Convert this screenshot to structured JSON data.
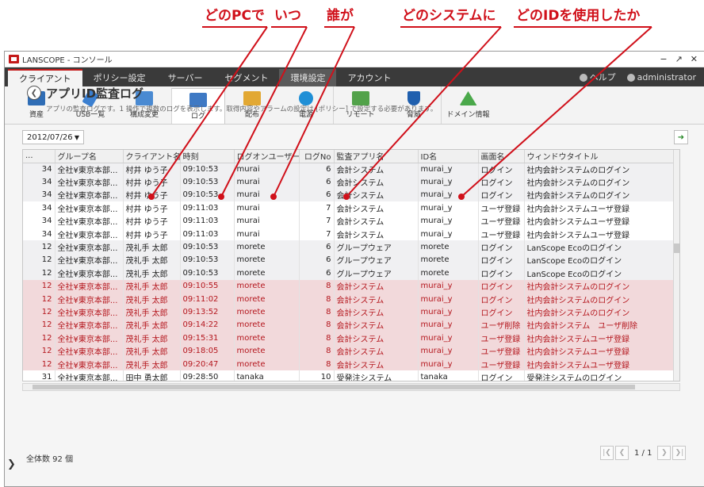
{
  "annotations": [
    "どのPCで",
    "いつ",
    "誰が",
    "どのシステムに",
    "どのIDを使用したか"
  ],
  "window": {
    "title": "LANSCOPE - コンソール",
    "controls": [
      "−",
      "↗",
      "✕"
    ]
  },
  "menubar": {
    "tabs": [
      "クライアント",
      "ポリシー設定",
      "サーバー",
      "セグメント",
      "環境設定",
      "アカウント"
    ],
    "help": "ヘルプ",
    "user": "administrator"
  },
  "toolbar": [
    "資産",
    "USB一覧",
    "構成変更",
    "ログ",
    "配布",
    "電源",
    "リモート",
    "脅威",
    "ドメイン情報"
  ],
  "page": {
    "title": "アプリID監査ログ",
    "description": "アプリの監査ログです。1 操作で複数のログを表示します。取得内容やアラームの設定は [ポリシー] で設定する必要があります。"
  },
  "date_filter": "2012/07/26",
  "table": {
    "columns": [
      "...",
      "グループ名",
      "クライアント名",
      "時刻",
      "ログオンユーザー名",
      "ログNo",
      "監査アプリ名",
      "ID名",
      "画面名",
      "ウィンドウタイトル"
    ],
    "rows": [
      {
        "style": "gray",
        "cells": [
          "34",
          "全社¥東京本部...",
          "村井 ゆう子",
          "09:10:53",
          "murai",
          "6",
          "会計システム",
          "murai_y",
          "ログイン",
          "社内会計システムのログイン"
        ]
      },
      {
        "style": "gray",
        "cells": [
          "34",
          "全社¥東京本部...",
          "村井 ゆう子",
          "09:10:53",
          "murai",
          "6",
          "会計システム",
          "murai_y",
          "ログイン",
          "社内会計システムのログイン"
        ]
      },
      {
        "style": "gray",
        "cells": [
          "34",
          "全社¥東京本部...",
          "村井 ゆう子",
          "09:10:53",
          "murai",
          "6",
          "会計システム",
          "murai_y",
          "ログイン",
          "社内会計システムのログイン"
        ]
      },
      {
        "style": "white",
        "cells": [
          "34",
          "全社¥東京本部...",
          "村井 ゆう子",
          "09:11:03",
          "murai",
          "7",
          "会計システム",
          "murai_y",
          "ユーザ登録",
          "社内会計システムユーザ登録"
        ]
      },
      {
        "style": "white",
        "cells": [
          "34",
          "全社¥東京本部...",
          "村井 ゆう子",
          "09:11:03",
          "murai",
          "7",
          "会計システム",
          "murai_y",
          "ユーザ登録",
          "社内会計システムユーザ登録"
        ]
      },
      {
        "style": "white",
        "cells": [
          "34",
          "全社¥東京本部...",
          "村井 ゆう子",
          "09:11:03",
          "murai",
          "7",
          "会計システム",
          "murai_y",
          "ユーザ登録",
          "社内会計システムユーザ登録"
        ]
      },
      {
        "style": "gray",
        "cells": [
          "12",
          "全社¥東京本部...",
          "茂礼手 太郎",
          "09:10:53",
          "morete",
          "6",
          "グループウェア",
          "morete",
          "ログイン",
          "LanScope Ecoのログイン"
        ]
      },
      {
        "style": "gray",
        "cells": [
          "12",
          "全社¥東京本部...",
          "茂礼手 太郎",
          "09:10:53",
          "morete",
          "6",
          "グループウェア",
          "morete",
          "ログイン",
          "LanScope Ecoのログイン"
        ]
      },
      {
        "style": "gray",
        "cells": [
          "12",
          "全社¥東京本部...",
          "茂礼手 太郎",
          "09:10:53",
          "morete",
          "6",
          "グループウェア",
          "morete",
          "ログイン",
          "LanScope Ecoのログイン"
        ]
      },
      {
        "style": "red",
        "cells": [
          "12",
          "全社¥東京本部...",
          "茂礼手 太郎",
          "09:10:55",
          "morete",
          "8",
          "会計システム",
          "murai_y",
          "ログイン",
          "社内会計システムのログイン"
        ]
      },
      {
        "style": "red",
        "cells": [
          "12",
          "全社¥東京本部...",
          "茂礼手 太郎",
          "09:11:02",
          "morete",
          "8",
          "会計システム",
          "murai_y",
          "ログイン",
          "社内会計システムのログイン"
        ]
      },
      {
        "style": "red",
        "cells": [
          "12",
          "全社¥東京本部...",
          "茂礼手 太郎",
          "09:13:52",
          "morete",
          "8",
          "会計システム",
          "murai_y",
          "ログイン",
          "社内会計システムのログイン"
        ]
      },
      {
        "style": "red",
        "cells": [
          "12",
          "全社¥東京本部...",
          "茂礼手 太郎",
          "09:14:22",
          "morete",
          "8",
          "会計システム",
          "murai_y",
          "ユーザ削除",
          "社内会計システム　ユーザ削除"
        ]
      },
      {
        "style": "red",
        "cells": [
          "12",
          "全社¥東京本部...",
          "茂礼手 太郎",
          "09:15:31",
          "morete",
          "8",
          "会計システム",
          "murai_y",
          "ユーザ登録",
          "社内会計システムユーザ登録"
        ]
      },
      {
        "style": "red",
        "cells": [
          "12",
          "全社¥東京本部...",
          "茂礼手 太郎",
          "09:18:05",
          "morete",
          "8",
          "会計システム",
          "murai_y",
          "ユーザ登録",
          "社内会計システムユーザ登録"
        ]
      },
      {
        "style": "red",
        "cells": [
          "12",
          "全社¥東京本部...",
          "茂礼手 太郎",
          "09:20:47",
          "morete",
          "8",
          "会計システム",
          "murai_y",
          "ユーザ登録",
          "社内会計システムユーザ登録"
        ]
      },
      {
        "style": "white",
        "cells": [
          "31",
          "全社¥東京本部...",
          "田中 勇太郎",
          "09:28:50",
          "tanaka",
          "10",
          "受発注システム",
          "tanaka",
          "ログイン",
          "受発注システムのログイン"
        ]
      }
    ]
  },
  "footer": {
    "total": "全体数 92 個",
    "page": "1 / 1"
  }
}
